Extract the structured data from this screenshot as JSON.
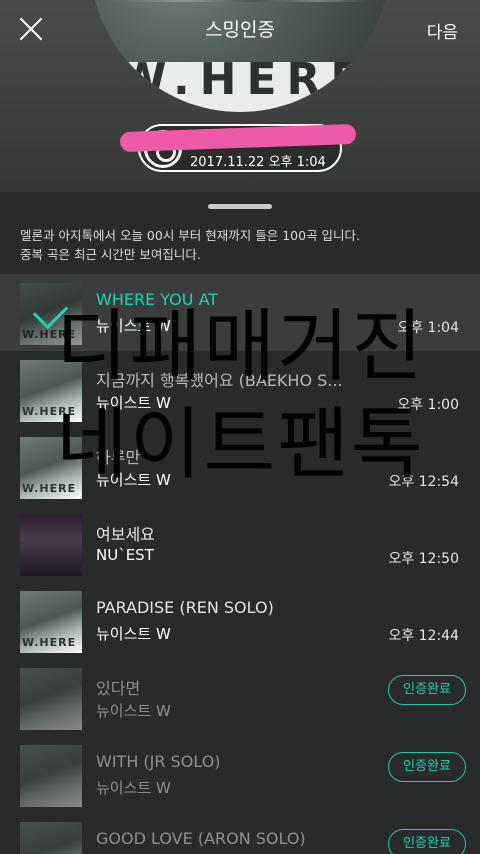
{
  "header": {
    "title": "스밍인증",
    "next_label": "다음",
    "album_text": "W.HERE",
    "badge_date": "2017.11.22 오후 1:04"
  },
  "notice": {
    "line1": "멜론과 아지톡에서 오늘 00시 부터 현재까지 들은 100곡 입니다.",
    "line2": "중복 곡은 최근 시간만 보여집니다."
  },
  "songs": [
    {
      "title": "WHERE YOU AT",
      "artist": "뉴이스트 W",
      "time": "오후 1:04"
    },
    {
      "title": "지금까지 행복했어요 (BAEKHO S...",
      "artist": "뉴이스트 W",
      "time": "오후 1:00"
    },
    {
      "title": "하루만",
      "artist": "뉴이스트 W",
      "time": "오후 12:54"
    },
    {
      "title": "여보세요",
      "artist": "NU`EST",
      "time": "오후 12:50"
    },
    {
      "title": "PARADISE (REN SOLO)",
      "artist": "뉴이스트 W",
      "time": "오후 12:44"
    },
    {
      "title": "있다면",
      "artist": "뉴이스트 W",
      "status": "인증완료"
    },
    {
      "title": "WITH (JR SOLO)",
      "artist": "뉴이스트 W",
      "status": "인증완료"
    },
    {
      "title": "GOOD LOVE (ARON SOLO)",
      "artist": "",
      "status": "인증완료"
    }
  ],
  "thumb_text": "W.HERE",
  "watermark": {
    "line1": "디패매거진",
    "line2": "네이트팬톡"
  },
  "colors": {
    "accent": "#1fd3b5",
    "scribble": "#ef5aa6",
    "background": "#282b2a"
  }
}
